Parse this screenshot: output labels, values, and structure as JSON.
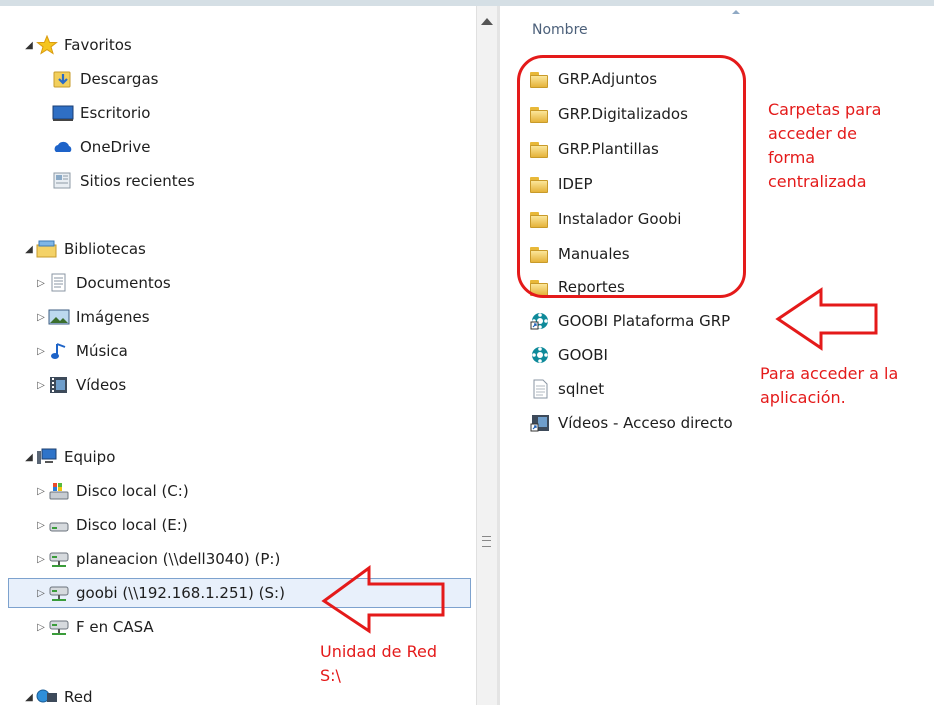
{
  "nav": {
    "favorites": {
      "label": "Favoritos",
      "items": [
        {
          "label": "Descargas",
          "icon": "downloads-icon"
        },
        {
          "label": "Escritorio",
          "icon": "desktop-icon"
        },
        {
          "label": "OneDrive",
          "icon": "onedrive-icon"
        },
        {
          "label": "Sitios recientes",
          "icon": "recent-places-icon"
        }
      ]
    },
    "libraries": {
      "label": "Bibliotecas",
      "items": [
        {
          "label": "Documentos",
          "icon": "documents-icon"
        },
        {
          "label": "Imágenes",
          "icon": "pictures-icon"
        },
        {
          "label": "Música",
          "icon": "music-icon"
        },
        {
          "label": "Vídeos",
          "icon": "videos-icon"
        }
      ]
    },
    "computer": {
      "label": "Equipo",
      "items": [
        {
          "label": "Disco local (C:)",
          "icon": "system-drive-icon"
        },
        {
          "label": "Disco local (E:)",
          "icon": "local-drive-icon"
        },
        {
          "label": "planeacion (\\\\dell3040) (P:)",
          "icon": "network-drive-icon"
        },
        {
          "label": "goobi (\\\\192.168.1.251) (S:)",
          "icon": "network-drive-icon",
          "selected": true
        },
        {
          "label": "F en CASA",
          "icon": "network-drive-icon"
        }
      ]
    },
    "network": {
      "label": "Red"
    }
  },
  "files": {
    "column_header": "Nombre",
    "items": [
      {
        "name": "GRP.Adjuntos",
        "type": "folder"
      },
      {
        "name": "GRP.Digitalizados",
        "type": "folder"
      },
      {
        "name": "GRP.Plantillas",
        "type": "folder"
      },
      {
        "name": "IDEP",
        "type": "folder"
      },
      {
        "name": "Instalador Goobi",
        "type": "folder"
      },
      {
        "name": "Manuales",
        "type": "folder"
      },
      {
        "name": "Reportes",
        "type": "folder"
      },
      {
        "name": "GOOBI Plataforma GRP",
        "type": "shortcut"
      },
      {
        "name": "GOOBI",
        "type": "app"
      },
      {
        "name": "sqlnet",
        "type": "file"
      },
      {
        "name": "Vídeos - Acceso directo",
        "type": "shortcut"
      }
    ]
  },
  "annotations": {
    "folders_note_lines": [
      "Carpetas para",
      "acceder de",
      "forma",
      "centralizada"
    ],
    "app_note_lines": [
      "Para acceder a la",
      "aplicación."
    ],
    "drive_note_lines": [
      "Unidad de Red",
      "S:\\"
    ]
  },
  "colors": {
    "annotation": "#e41a1a",
    "selection": "#e8f0fb",
    "selection_border": "#7da2ce"
  }
}
